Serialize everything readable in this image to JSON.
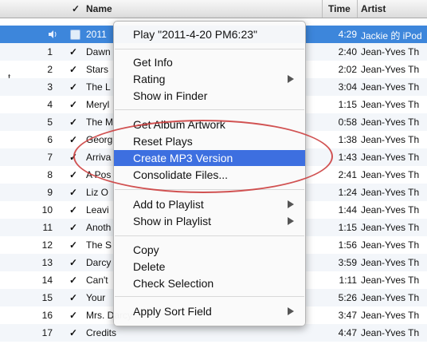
{
  "header": {
    "check": "✓",
    "name": "Name",
    "time": "Time",
    "artist": "Artist"
  },
  "side_mark": "t",
  "rows": [
    {
      "num": "",
      "check": "",
      "name": "2011",
      "time": "4:29",
      "artist": "Jackie 的 iPod"
    },
    {
      "num": "1",
      "check": "✓",
      "name": "Dawn",
      "time": "2:40",
      "artist": "Jean-Yves Th"
    },
    {
      "num": "2",
      "check": "✓",
      "name": "Stars",
      "time": "2:02",
      "artist": "Jean-Yves Th"
    },
    {
      "num": "3",
      "check": "✓",
      "name": "The L",
      "time": "3:04",
      "artist": "Jean-Yves Th"
    },
    {
      "num": "4",
      "check": "✓",
      "name": "Meryl",
      "time": "1:15",
      "artist": "Jean-Yves Th"
    },
    {
      "num": "5",
      "check": "✓",
      "name": "The M",
      "time": "0:58",
      "artist": "Jean-Yves Th"
    },
    {
      "num": "6",
      "check": "✓",
      "name": "Georg",
      "time": "1:38",
      "artist": "Jean-Yves Th"
    },
    {
      "num": "7",
      "check": "✓",
      "name": "Arriva",
      "time": "1:43",
      "artist": "Jean-Yves Th"
    },
    {
      "num": "8",
      "check": "✓",
      "name": "A Pos",
      "time": "2:41",
      "artist": "Jean-Yves Th"
    },
    {
      "num": "9",
      "check": "✓",
      "name": "Liz O",
      "time": "1:24",
      "artist": "Jean-Yves Th"
    },
    {
      "num": "10",
      "check": "✓",
      "name": "Leavi",
      "time": "1:44",
      "artist": "Jean-Yves Th"
    },
    {
      "num": "11",
      "check": "✓",
      "name": "Anoth",
      "time": "1:15",
      "artist": "Jean-Yves Th"
    },
    {
      "num": "12",
      "check": "✓",
      "name": "The S",
      "time": "1:56",
      "artist": "Jean-Yves Th"
    },
    {
      "num": "13",
      "check": "✓",
      "name": "Darcy",
      "time": "3:59",
      "artist": "Jean-Yves Th"
    },
    {
      "num": "14",
      "check": "✓",
      "name": "Can't",
      "time": "1:11",
      "artist": "Jean-Yves Th"
    },
    {
      "num": "15",
      "check": "✓",
      "name": "Your",
      "time": "5:26",
      "artist": "Jean-Yves Th"
    },
    {
      "num": "16",
      "check": "✓",
      "name": "Mrs. Darcy",
      "time": "3:47",
      "artist": "Jean-Yves Th"
    },
    {
      "num": "17",
      "check": "✓",
      "name": "Credits",
      "time": "4:47",
      "artist": "Jean-Yves Th"
    }
  ],
  "menu": {
    "play": "Play \"2011-4-20 PM6:23\"",
    "get_info": "Get Info",
    "rating": "Rating",
    "show_in_finder": "Show in Finder",
    "get_album_artwork": "Get Album Artwork",
    "reset_plays": "Reset Plays",
    "create_mp3": "Create MP3 Version",
    "consolidate": "Consolidate Files...",
    "add_to_playlist": "Add to Playlist",
    "show_in_playlist": "Show in Playlist",
    "copy": "Copy",
    "delete": "Delete",
    "check_selection": "Check Selection",
    "apply_sort_field": "Apply Sort Field"
  },
  "colors": {
    "selection": "#3d86db",
    "menu_highlight": "#3d6fe0",
    "annotation": "#cc3f3f"
  },
  "icons": {
    "speaker": "speaker-icon",
    "submenu": "submenu-arrow-icon"
  }
}
